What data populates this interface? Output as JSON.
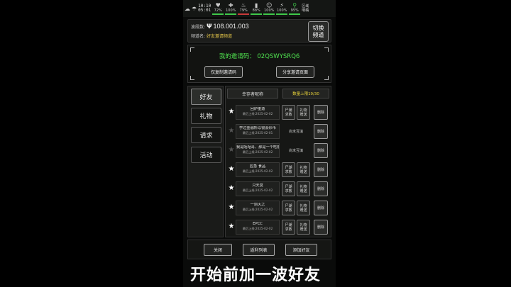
{
  "status": {
    "clock_top": "10:10",
    "clock_bottom": "05:01",
    "meters": [
      {
        "value": "72%",
        "color": "#3fc94a"
      },
      {
        "value": "100%",
        "color": "#3fc94a"
      },
      {
        "value": "79%",
        "color": "#c93a3a"
      },
      {
        "value": "88%",
        "color": "#3fc94a"
      },
      {
        "value": "100%",
        "color": "#3fc94a"
      },
      {
        "value": "100%",
        "color": "#3fc94a"
      },
      {
        "value": "95%",
        "color": "#3fc94a"
      }
    ],
    "zone": "区域",
    "zone2": "明确"
  },
  "header": {
    "band_label": "波段数:",
    "band_value": "108.001.003",
    "channel_label": "频道名:",
    "channel_value": "好友邀请频道",
    "switch_button": "切换\n频道"
  },
  "invite": {
    "code_line": "我的邀请码： 02QSWYSRQ6",
    "copy_button": "仅复制邀请码",
    "share_button": "分享邀请页面"
  },
  "tabs": [
    "好友",
    "礼物",
    "请求",
    "活动"
  ],
  "list_header": {
    "name_col": "幸存者昵称",
    "count_col": "数量上限19/30"
  },
  "friends": [
    {
      "name": "回炉重造",
      "last": "最后上线:2025-02-02",
      "star": true,
      "actions": [
        "尸潮\n求救",
        "礼物\n赠送"
      ],
      "delete": "删除"
    },
    {
      "name": "学过金融所以很会炒币",
      "last": "最后上线:2025-02-01",
      "star": false,
      "status": "尚未互填",
      "delete": "删除"
    },
    {
      "name": "我是咕咕哥、那是一个吃饭",
      "last": "最后上线:2025-02-02",
      "star": false,
      "status": "尚未互填",
      "delete": "删除"
    },
    {
      "name": "应急 食品",
      "last": "最后上线:2025-02-02",
      "star": true,
      "actions": [
        "尸潮\n求救",
        "礼物\n赠送"
      ],
      "delete": "删除"
    },
    {
      "name": "只天莫",
      "last": "最后上线:2025-02-02",
      "star": true,
      "actions": [
        "尸潮\n求救",
        "礼物\n赠送"
      ],
      "delete": "删除"
    },
    {
      "name": "一剑灭之",
      "last": "最后上线:2025-02-02",
      "star": true,
      "actions": [
        "尸潮\n求救",
        "礼物\n赠送"
      ],
      "delete": "删除"
    },
    {
      "name": "EPCC",
      "last": "最后上线:2025-02-02",
      "star": true,
      "actions": [
        "尸潮\n求救",
        "礼物\n赠送"
      ],
      "delete": "删除"
    }
  ],
  "bottom": {
    "close": "关闭",
    "rebate": "返利列表",
    "add": "添加好友"
  },
  "caption": "开始前加一波好友"
}
